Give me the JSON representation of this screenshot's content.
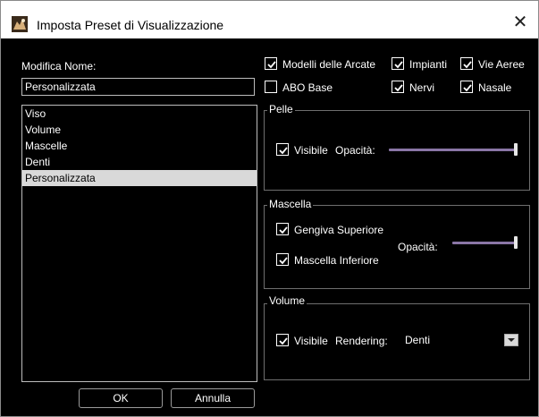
{
  "window": {
    "title": "Imposta Preset di Visualizzazione",
    "close_glyph": "✕"
  },
  "left": {
    "name_label": "Modifica Nome:",
    "name_value": "Personalizzata",
    "list_items": [
      {
        "label": "Viso",
        "selected": false
      },
      {
        "label": "Volume",
        "selected": false
      },
      {
        "label": "Mascelle",
        "selected": false
      },
      {
        "label": "Denti",
        "selected": false
      },
      {
        "label": "Personalizzata",
        "selected": true
      }
    ],
    "ok_label": "OK",
    "cancel_label": "Annulla"
  },
  "options": {
    "modelli_arcate": {
      "label": "Modelli delle Arcate",
      "checked": true
    },
    "impianti": {
      "label": "Impianti",
      "checked": true
    },
    "vie_aeree": {
      "label": "Vie Aeree",
      "checked": true
    },
    "abo_base": {
      "label": "ABO Base",
      "checked": false
    },
    "nervi": {
      "label": "Nervi",
      "checked": true
    },
    "nasale": {
      "label": "Nasale",
      "checked": true
    }
  },
  "pelle": {
    "title": "Pelle",
    "visibile": {
      "label": "Visibile",
      "checked": true
    },
    "opacity_label": "Opacità:",
    "opacity_value": 1.0
  },
  "mascella": {
    "title": "Mascella",
    "gengiva": {
      "label": "Gengiva Superiore",
      "checked": true
    },
    "inferiore": {
      "label": "Mascella Inferiore",
      "checked": true
    },
    "opacity_label": "Opacità:",
    "opacity_value": 1.0
  },
  "volume": {
    "title": "Volume",
    "visibile": {
      "label": "Visibile",
      "checked": true
    },
    "rendering_label": "Rendering:",
    "rendering_value": "Denti"
  },
  "colors": {
    "slider_track": "#8a76a6",
    "selection": "#d9d9d9"
  }
}
